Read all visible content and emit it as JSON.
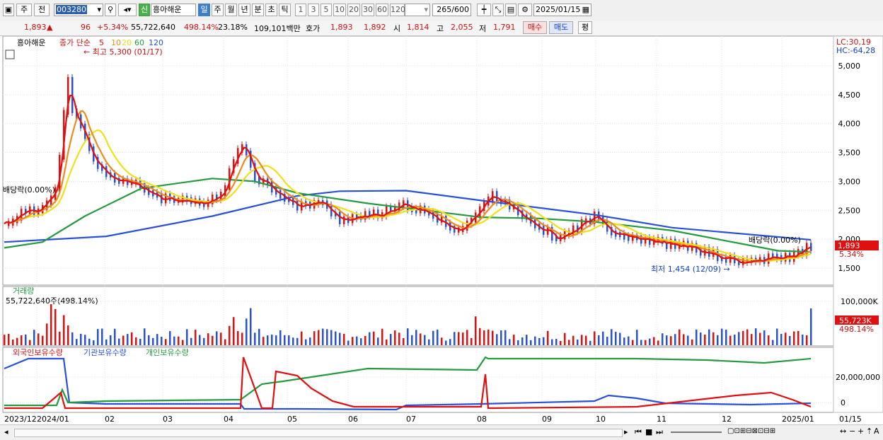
{
  "toolbar": {
    "type_select": "주",
    "prev_label": "전",
    "code": "003280",
    "name_tag": "신",
    "stock_name": "흥아해운",
    "periods": [
      "일",
      "주",
      "월",
      "년",
      "분",
      "초",
      "틱"
    ],
    "active_period": "일",
    "intervals": [
      "1",
      "3",
      "5",
      "10",
      "20",
      "30",
      "60",
      "120"
    ],
    "count_current": "265",
    "count_total": "/600",
    "date": "2025/01/15"
  },
  "quote": {
    "price": "1,893",
    "arrow": "▲",
    "change": "96",
    "change_pct": "+5.34%",
    "volume": "55,722,640",
    "volume_pct": "498.14%",
    "turnover": "23.18%",
    "amount": "109,101백만",
    "ask_label": "호가",
    "ask1": "1,893",
    "ask2": "1,892",
    "open_label": "시",
    "open": "1,814",
    "high_label": "고",
    "high": "2,055",
    "low_label": "저",
    "low": "1,791",
    "buy_label": "매수",
    "sell_label": "매도",
    "eval_label": "평"
  },
  "price_panel": {
    "stock_label": "흥아해운",
    "ma_title": "종가 단순",
    "ma_periods": [
      "5",
      "10",
      "20",
      "60",
      "120"
    ],
    "ma_colors": [
      "#e01010",
      "#f08a1a",
      "#f0e018",
      "#259a3f",
      "#2850d8"
    ],
    "lc": "LC:30,19",
    "hc": "HC:-64,28",
    "high_annot": "최고 5,300 (01/17)",
    "low_annot": "최저 1,454 (12/09)",
    "div_left": "배당락(0.00%)",
    "div_right": "배당락(0.00%)",
    "last_price": "1,893",
    "last_change": "5.34%",
    "y_ticks": [
      "5,000",
      "4,500",
      "4,000",
      "3,500",
      "3,000",
      "2,500",
      "2,000",
      "1,500"
    ]
  },
  "volume_panel": {
    "title": "거래량",
    "value": "55,722,640주(498.14%)",
    "y_tick": "100,000K",
    "last_value": "55,723K",
    "last_pct": "498.14%"
  },
  "holdings_panel": {
    "series": [
      "외국인보유수량",
      "기관보유수량",
      "개인보유수량"
    ],
    "colors": [
      "#e01010",
      "#2850d8",
      "#259a3f"
    ],
    "y_ticks": [
      "20,000,000",
      "0"
    ]
  },
  "x_axis": {
    "labels": [
      "2023/12",
      "2024/01",
      "02",
      "03",
      "04",
      "05",
      "06",
      "07",
      "08",
      "09",
      "10",
      "11",
      "12",
      "2025/01",
      "01/15"
    ]
  },
  "chart_data": [
    {
      "type": "line",
      "title": "흥아해운",
      "x": [
        "2023/12",
        "2024/01",
        "02",
        "03",
        "04",
        "05",
        "06",
        "07",
        "08",
        "09",
        "10",
        "11",
        "12",
        "2025/01",
        "01/15"
      ],
      "series": [
        {
          "name": "5",
          "values": [
            2200,
            2450,
            3250,
            2750,
            2600,
            3500,
            2600,
            2400,
            2550,
            2250,
            2700,
            2250,
            2000,
            1850,
            1600,
            1650,
            1893
          ]
        },
        {
          "name": "120",
          "values": [
            1950,
            2000,
            2100,
            2250,
            2450,
            2700,
            2800,
            2850,
            2850,
            2850,
            2800,
            2650,
            2450,
            2250,
            2100,
            2000,
            1980
          ]
        }
      ],
      "ylim": [
        1200,
        5500
      ]
    },
    {
      "type": "bar",
      "title": "거래량",
      "values": [
        55722640
      ],
      "ylim": [
        0,
        130000000
      ]
    }
  ]
}
